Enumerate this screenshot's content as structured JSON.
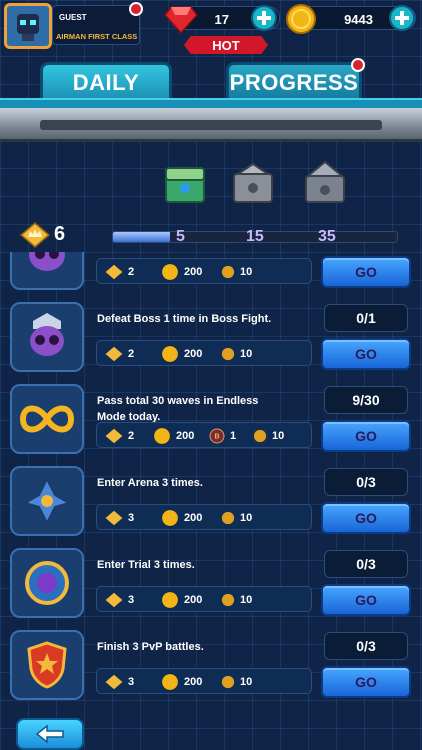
{
  "player": {
    "name": "GUEST",
    "rank": "AIRMAN FIRST CLASS"
  },
  "currency": {
    "gems": "17",
    "coins": "9443"
  },
  "hot_label": "HOT",
  "tabs": [
    {
      "label": "DAILY",
      "active": true
    },
    {
      "label": "PROGRESS",
      "active": false
    }
  ],
  "milestones": {
    "score": "6",
    "progress_fraction": 0.2,
    "labels": [
      "5",
      "15",
      "35"
    ]
  },
  "quests": [
    {
      "title": "",
      "progress": "",
      "rewards": {
        "stars": "2",
        "coins": "200",
        "extra": "10"
      },
      "button": "GO"
    },
    {
      "title": "Defeat Boss 1 time in Boss Fight.",
      "progress": "0/1",
      "rewards": {
        "stars": "2",
        "coins": "200",
        "extra": "10"
      },
      "button": "GO"
    },
    {
      "title": "Pass total 30 waves in Endless Mode today.",
      "progress": "9/30",
      "rewards": {
        "stars": "2",
        "coins": "200",
        "badge": "1",
        "extra": "10"
      },
      "button": "GO"
    },
    {
      "title": "Enter Arena 3 times.",
      "progress": "0/3",
      "rewards": {
        "stars": "3",
        "coins": "200",
        "extra": "10"
      },
      "button": "GO"
    },
    {
      "title": "Enter Trial 3 times.",
      "progress": "0/3",
      "rewards": {
        "stars": "3",
        "coins": "200",
        "extra": "10"
      },
      "button": "GO"
    },
    {
      "title": "Finish 3 PvP battles.",
      "progress": "0/3",
      "rewards": {
        "stars": "3",
        "coins": "200",
        "extra": "10"
      },
      "button": "GO"
    }
  ],
  "colors": {
    "accent": "#1ec0d8",
    "gold": "#f2b93b",
    "hot": "#d3172b",
    "button": "#2f85f0"
  },
  "icons": [
    "avatar-robot-icon",
    "ruby-icon",
    "coin-icon",
    "plus-icon",
    "crown-star-icon",
    "chest-icon",
    "skull-icon",
    "infinity-icon",
    "ship-icon",
    "portal-icon",
    "shield-icon",
    "back-arrow-icon"
  ]
}
